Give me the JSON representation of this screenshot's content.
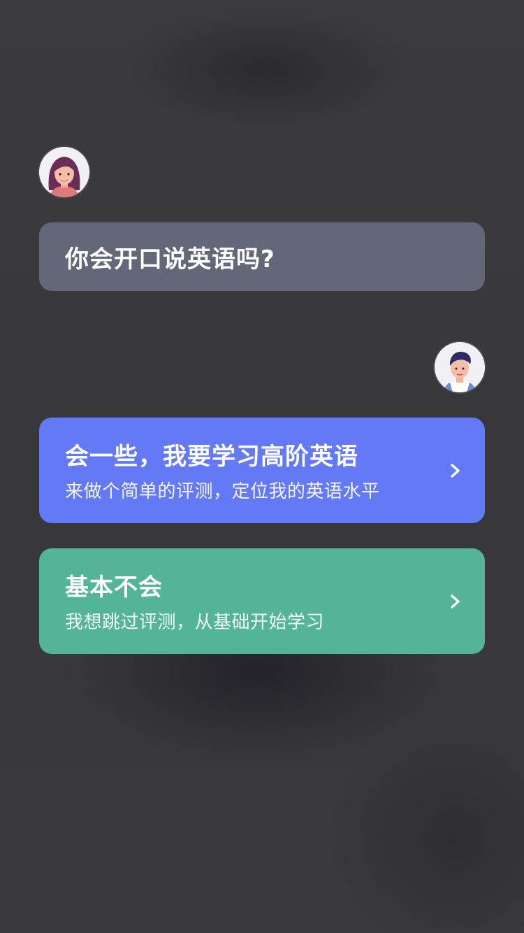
{
  "question": {
    "text": "你会开口说英语吗?"
  },
  "options": [
    {
      "title": "会一些，我要学习高阶英语",
      "subtitle": "来做个简单的评测，定位我的英语水平",
      "color": "#6379f6"
    },
    {
      "title": "基本不会",
      "subtitle": "我想跳过评测，从基础开始学习",
      "color": "#53b595"
    }
  ],
  "icons": {
    "teacher_avatar": "female-avatar-icon",
    "user_avatar": "male-avatar-icon",
    "chevron": "chevron-right-icon"
  },
  "colors": {
    "background": "#3a3a3e",
    "question_bubble": "#646777"
  }
}
